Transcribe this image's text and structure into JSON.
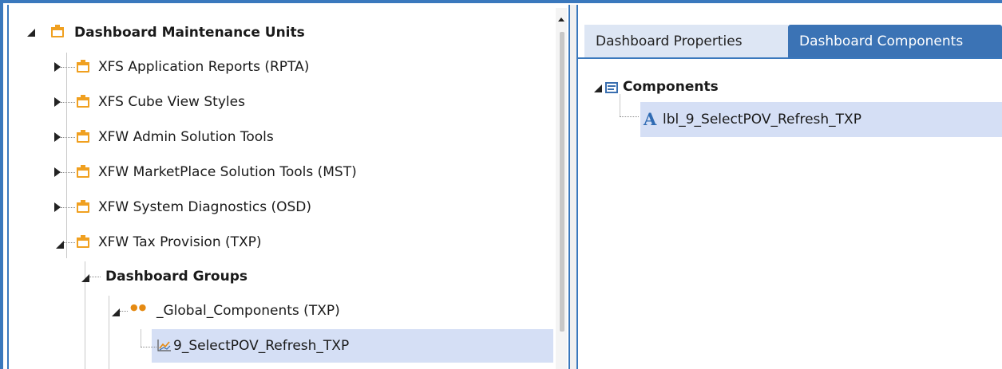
{
  "tree": {
    "root": {
      "label": "Dashboard Maintenance Units"
    },
    "units": [
      {
        "label": "XFS Application Reports (RPTA)"
      },
      {
        "label": "XFS Cube View Styles"
      },
      {
        "label": "XFW Admin Solution Tools"
      },
      {
        "label": "XFW MarketPlace Solution Tools (MST)"
      },
      {
        "label": "XFW System Diagnostics (OSD)"
      },
      {
        "label": "XFW Tax Provision (TXP)"
      }
    ],
    "groups_label": "Dashboard Groups",
    "group": {
      "label": "_Global_Components (TXP)"
    },
    "dashboard": {
      "label": "9_SelectPOV_Refresh_TXP"
    }
  },
  "tabs": [
    {
      "label": "Dashboard Properties"
    },
    {
      "label": "Dashboard Components"
    }
  ],
  "components": {
    "header": "Components",
    "items": [
      {
        "label": "lbl_9_SelectPOV_Refresh_TXP"
      }
    ]
  },
  "colors": {
    "accent": "#3a78bd",
    "active_tab": "#3b73b5",
    "selection": "#d5dff5",
    "folder": "#f0a020"
  }
}
